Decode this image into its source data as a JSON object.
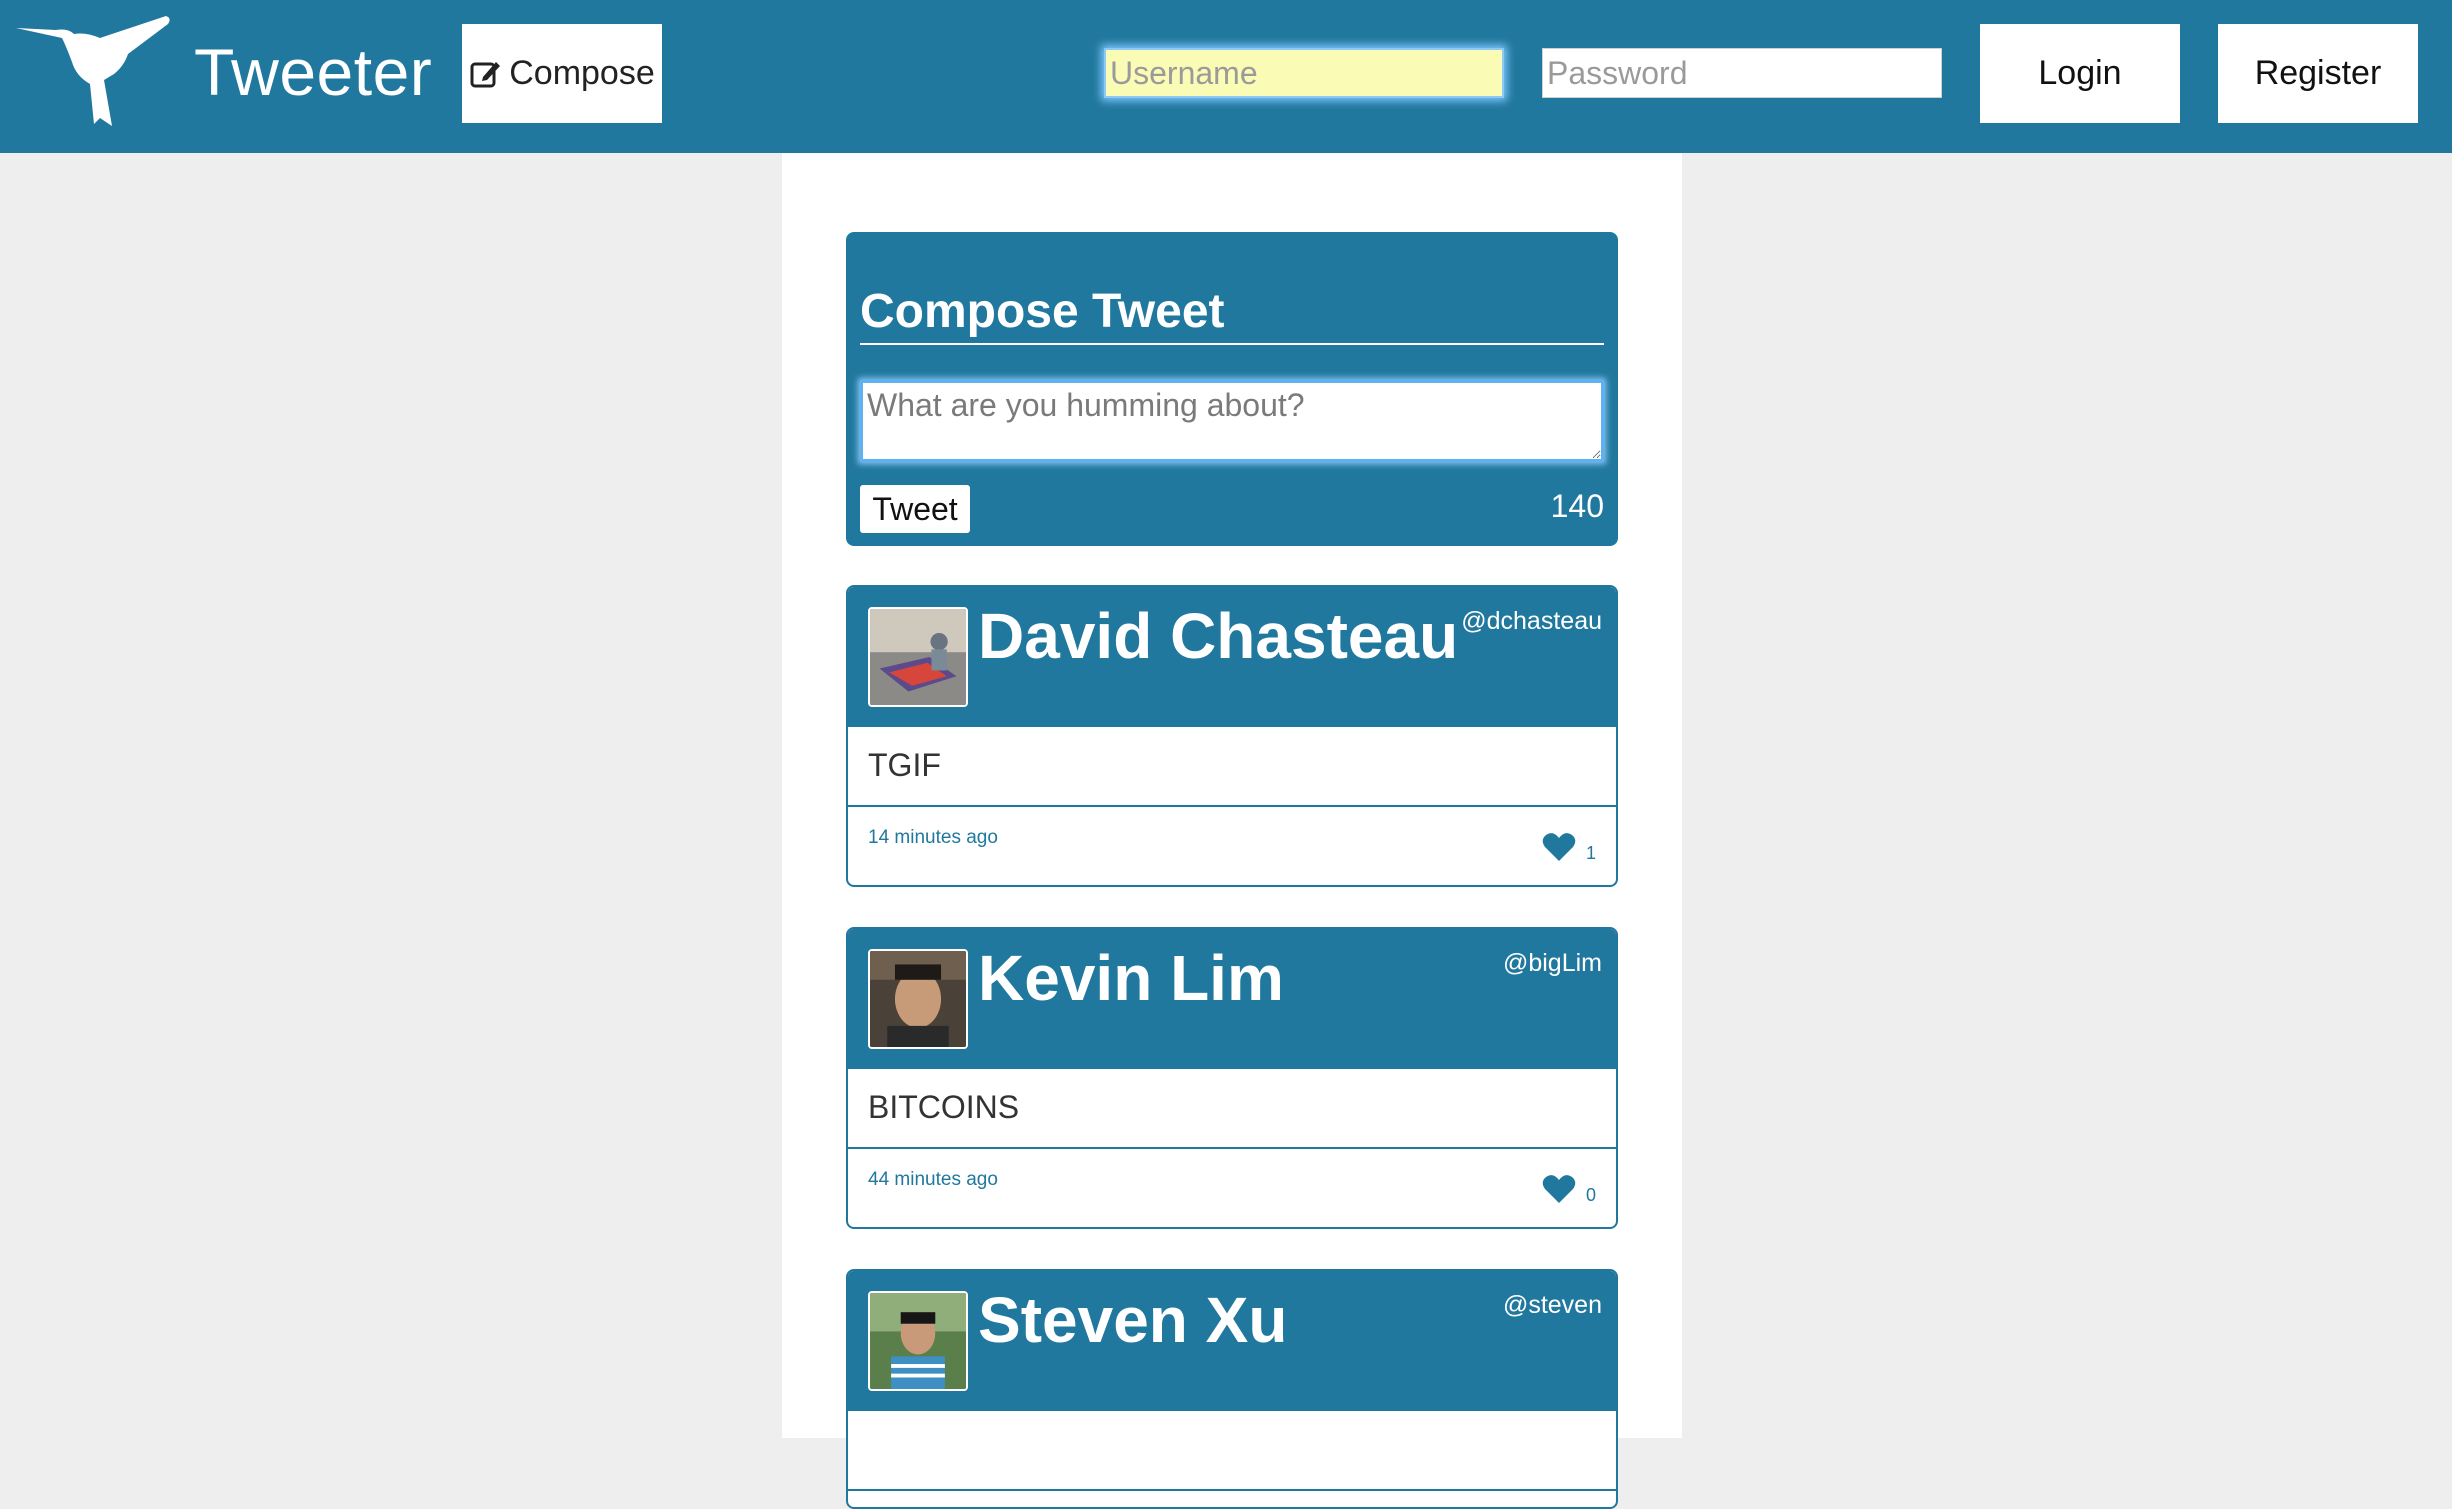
{
  "nav": {
    "brand": "Tweeter",
    "compose_label": "Compose",
    "username_placeholder": "Username",
    "password_placeholder": "Password",
    "login_label": "Login",
    "register_label": "Register",
    "icons": {
      "logo": "hummingbird-icon",
      "compose": "pencil-square-icon"
    }
  },
  "compose": {
    "title": "Compose Tweet",
    "placeholder": "What are you humming about?",
    "tweet_label": "Tweet",
    "char_count": "140"
  },
  "tweets": [
    {
      "name": "David Chasteau",
      "handle": "@dchasteau",
      "text": "TGIF",
      "time": "14 minutes ago",
      "likes": "1"
    },
    {
      "name": "Kevin Lim",
      "handle": "@bigLim",
      "text": "BITCOINS",
      "time": "44 minutes ago",
      "likes": "0"
    },
    {
      "name": "Steven Xu",
      "handle": "@steven",
      "text": "",
      "time": "",
      "likes": ""
    }
  ],
  "colors": {
    "brand": "#21789e",
    "page_background": "#eeeeee",
    "panel_background": "#ffffff",
    "autofill_highlight": "#fafcb6"
  }
}
